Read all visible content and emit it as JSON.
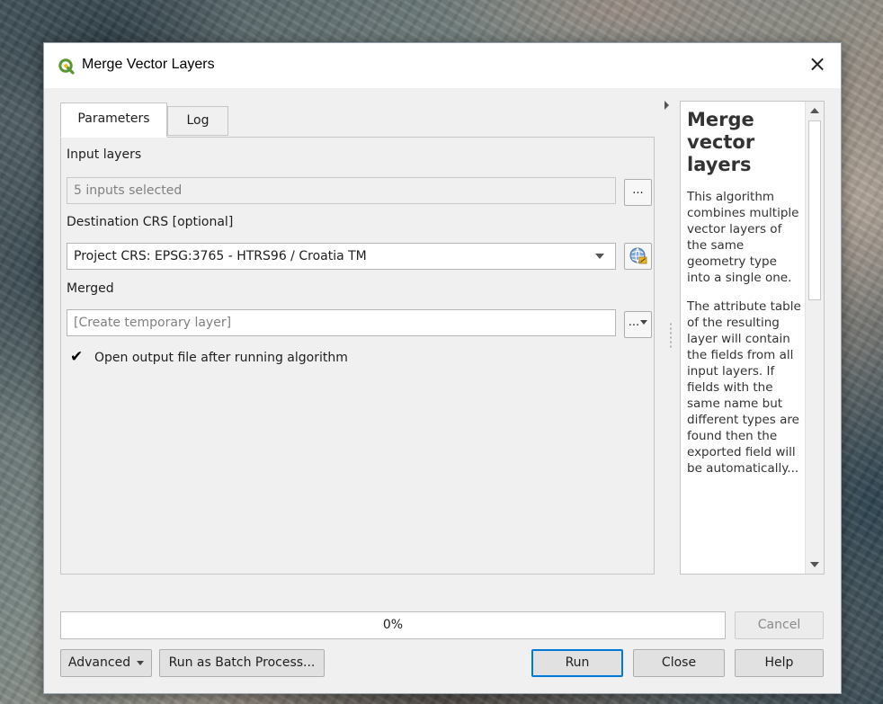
{
  "window": {
    "title": "Merge Vector Layers",
    "close_glyph": "×",
    "icon": "qgis-logo-icon"
  },
  "tabs": [
    {
      "label": "Parameters",
      "active": true
    },
    {
      "label": "Log",
      "active": false
    }
  ],
  "params": {
    "input_layers": {
      "label": "Input layers",
      "value": "5 inputs selected",
      "button": "..."
    },
    "crs": {
      "label": "Destination CRS [optional]",
      "value": "Project CRS: EPSG:3765 - HTRS96 / Croatia TM",
      "icon": "crs-globe-icon"
    },
    "merged": {
      "label": "Merged",
      "placeholder": "[Create temporary layer]",
      "button": "..."
    },
    "open_output": {
      "label": "Open output file after running algorithm",
      "checked": true,
      "glyph": "✔"
    }
  },
  "help": {
    "title": "Merge vector layers",
    "paragraphs": [
      "This algorithm combines multiple vector layers of the same geometry type into a single one.",
      "The attribute table of the resulting layer will contain the fields from all input layers. If fields with the same name but different types are found then the exported field will be automatically..."
    ]
  },
  "progress": {
    "value": 0,
    "text": "0%"
  },
  "buttons": {
    "cancel": "Cancel",
    "advanced": "Advanced",
    "batch": "Run as Batch Process...",
    "run": "Run",
    "close": "Close",
    "help": "Help"
  },
  "colors": {
    "accent": "#0078d7",
    "qgis_green": "#589632",
    "qgis_yellow": "#f0b91a"
  }
}
